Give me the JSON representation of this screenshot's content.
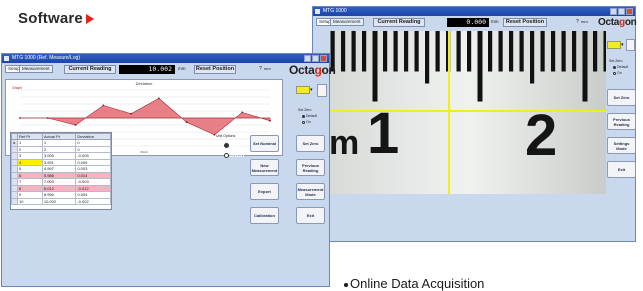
{
  "heading": "Software",
  "colors": {
    "accent_red": "#e2231a",
    "window_bg": "#c9d8ec",
    "titlebar": "#2f5fc4",
    "swatch_yellow": "#f2ee1d",
    "readout_bg": "#000000",
    "row_highlight": "#f3b4c0",
    "row_select": "#fff100"
  },
  "left_window": {
    "title": "MTG 1000 (Ref. Measure/Log)",
    "tabs": [
      "Setup",
      "Measurement"
    ],
    "current_reading_label": "Current Reading",
    "reading_value": "10.002",
    "units": "mm",
    "reset_label": "Reset Position",
    "help_label": "?",
    "help_units": "mm",
    "logo_text_a": "Octa",
    "logo_text_o": "g",
    "logo_text_b": "on",
    "chart_title": "Deviation",
    "chart_legend": "Graph",
    "chart_xlabel": "Point",
    "table_headers": [
      "",
      "Ref Pt",
      "Actual Pt",
      "Deviation"
    ],
    "rows": [
      {
        "marker": "▸",
        "ref": "1",
        "actual": "1",
        "dev": "0"
      },
      {
        "marker": "",
        "ref": "2",
        "actual": "2",
        "dev": "0"
      },
      {
        "marker": "",
        "ref": "3",
        "actual": "3.005",
        "dev": "-0.005"
      },
      {
        "marker": "",
        "ref": "4",
        "actual": "3.991",
        "dev": "0.009"
      },
      {
        "marker": "",
        "ref": "5",
        "actual": "4.997",
        "dev": "0.003"
      },
      {
        "marker": "",
        "ref": "6",
        "actual": "5.986",
        "dev": "0.014"
      },
      {
        "marker": "",
        "ref": "7",
        "actual": "7.003",
        "dev": "-0.003"
      },
      {
        "marker": "",
        "ref": "8",
        "actual": "8.012",
        "dev": "-0.012"
      },
      {
        "marker": "",
        "ref": "9",
        "actual": "8.996",
        "dev": "0.004"
      },
      {
        "marker": "",
        "ref": "10",
        "actual": "10.002",
        "dev": "-0.002"
      }
    ],
    "unit_options_label": "Unit Options",
    "unit_mm": "mm",
    "unit_inch": "inch",
    "buttons": {
      "set_nominal": "Set Nominal",
      "new_measurement": "New Measurement",
      "export": "Export",
      "calibration": "Calibration",
      "set_zero": "Set Zero",
      "previous_reading": "Previous Reading",
      "measurement_mode": "Measurement Mode",
      "exit": "Exit"
    },
    "set_zero_header": "Set Zero",
    "default_label": "Default",
    "on_label": "On"
  },
  "right_window": {
    "title": "MTG 1000",
    "tabs": [
      "Setup",
      "Measurement"
    ],
    "current_reading_label": "Current Reading",
    "reading_value": "0.000",
    "units": "mm",
    "reset_label": "Reset Position",
    "help_label": "?",
    "help_units": "mm",
    "logo_text_a": "Octa",
    "logo_text_o": "g",
    "logo_text_b": "on",
    "ruler_number_1": "1",
    "ruler_number_2": "2",
    "ruler_prefix": "m",
    "set_zero_header": "Set Zero",
    "default_label": "Default",
    "on_label": "On",
    "buttons": {
      "set_zero": "Set Zero",
      "previous_reading": "Previous Reading",
      "settings_mode": "Settings Mode",
      "exit": "Exit"
    }
  },
  "bullet": "Online Data Acquisition",
  "chart_data": {
    "type": "area",
    "title": "Deviation",
    "x": [
      1,
      2,
      3,
      4,
      5,
      6,
      7,
      8,
      9,
      10
    ],
    "series": [
      {
        "name": "Deviation",
        "values": [
          0,
          0,
          -0.005,
          0.009,
          0.003,
          0.014,
          -0.003,
          -0.012,
          0.004,
          -0.002
        ]
      }
    ],
    "ylim": [
      -0.02,
      0.02
    ],
    "grid": true
  }
}
